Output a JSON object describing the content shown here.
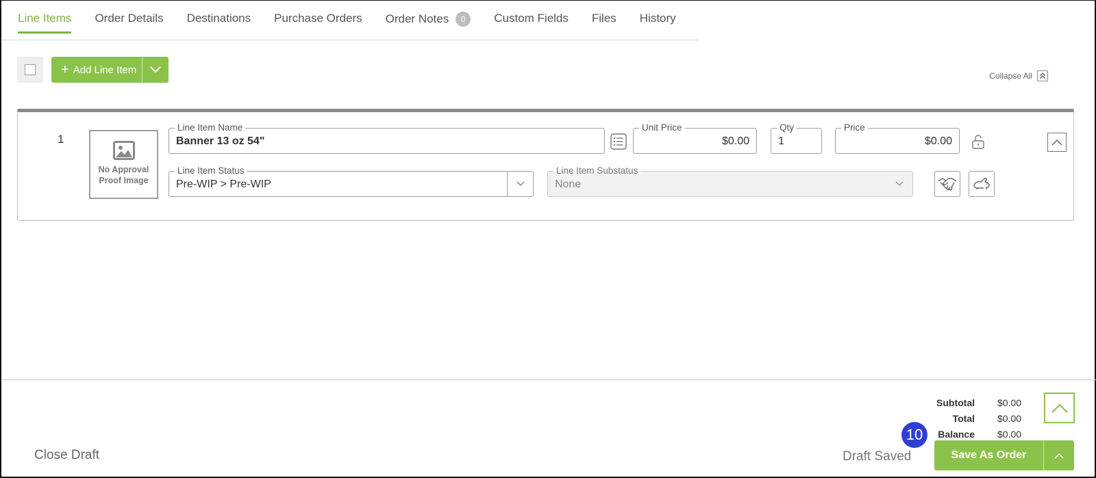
{
  "tabs": [
    {
      "label": "Line Items"
    },
    {
      "label": "Order Details"
    },
    {
      "label": "Destinations"
    },
    {
      "label": "Purchase Orders"
    },
    {
      "label": "Order Notes",
      "badge": "0"
    },
    {
      "label": "Custom Fields"
    },
    {
      "label": "Files"
    },
    {
      "label": "History"
    }
  ],
  "active_tab": "Line Items",
  "toolbar": {
    "add_line_item_label": "Add Line Item",
    "collapse_all_label": "Collapse All"
  },
  "line_item": {
    "number": "1",
    "proof_image_text": "No Approval Proof Image",
    "name_label": "Line Item Name",
    "name_value": "Banner 13 oz 54\"",
    "unit_price_label": "Unit Price",
    "unit_price_value": "$0.00",
    "qty_label": "Qty",
    "qty_value": "1",
    "price_label": "Price",
    "price_value": "$0.00",
    "status_label": "Line Item Status",
    "status_value": "Pre-WIP > Pre-WIP",
    "substatus_label": "Line Item Substatus",
    "substatus_value": "None",
    "icons": [
      "list-details-icon",
      "unlock-icon",
      "handshake-icon",
      "rabbit-icon",
      "chevron-up-icon"
    ]
  },
  "totals": {
    "subtotal_label": "Subtotal",
    "subtotal_value": "$0.00",
    "total_label": "Total",
    "total_value": "$0.00",
    "balance_label": "Balance",
    "balance_value": "$0.00"
  },
  "footer": {
    "close_draft_label": "Close Draft",
    "draft_saved_label": "Draft Saved",
    "save_as_order_label": "Save As Order",
    "step_badge": "10"
  },
  "colors": {
    "accent": "#8bc34a",
    "active_tab": "#7cb342",
    "step_badge": "#2f3fd6"
  }
}
